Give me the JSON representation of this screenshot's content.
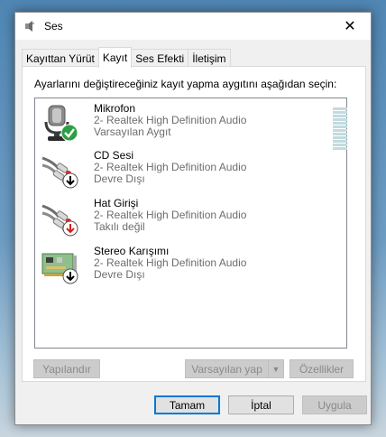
{
  "window": {
    "title": "Ses",
    "close_glyph": "✕"
  },
  "tabs": [
    {
      "label": "Kayıttan Yürüt",
      "active": false
    },
    {
      "label": "Kayıt",
      "active": true
    },
    {
      "label": "Ses Efekti",
      "active": false
    },
    {
      "label": "İletişim",
      "active": false
    }
  ],
  "instruction": "Ayarlarını değiştireceğiniz kayıt yapma aygıtını aşağıdan seçin:",
  "devices": [
    {
      "name": "Mikrofon",
      "driver": "2- Realtek High Definition Audio",
      "status": "Varsayılan Aygıt",
      "icon": "microphone-icon",
      "badge": "check-badge-icon",
      "badge_color": "#2c9f45"
    },
    {
      "name": "CD Sesi",
      "driver": "2- Realtek High Definition Audio",
      "status": "Devre Dışı",
      "icon": "rca-cable-icon",
      "badge": "down-arrow-badge-icon",
      "badge_color": "#000000"
    },
    {
      "name": "Hat Girişi",
      "driver": "2- Realtek High Definition Audio",
      "status": "Takılı değil",
      "icon": "rca-cable-icon",
      "badge": "down-arrow-badge-icon",
      "badge_color": "#d32020"
    },
    {
      "name": "Stereo Karışımı",
      "driver": "2- Realtek High Definition Audio",
      "status": "Devre Dışı",
      "icon": "sound-card-icon",
      "badge": "down-arrow-badge-icon",
      "badge_color": "#000000"
    }
  ],
  "buttons": {
    "configure": "Yapılandır",
    "set_default": "Varsayılan yap",
    "properties": "Özellikler",
    "ok": "Tamam",
    "cancel": "İptal",
    "apply": "Uygula"
  },
  "colors": {
    "accent": "#0078d7",
    "meter": "#c2dbe0"
  }
}
